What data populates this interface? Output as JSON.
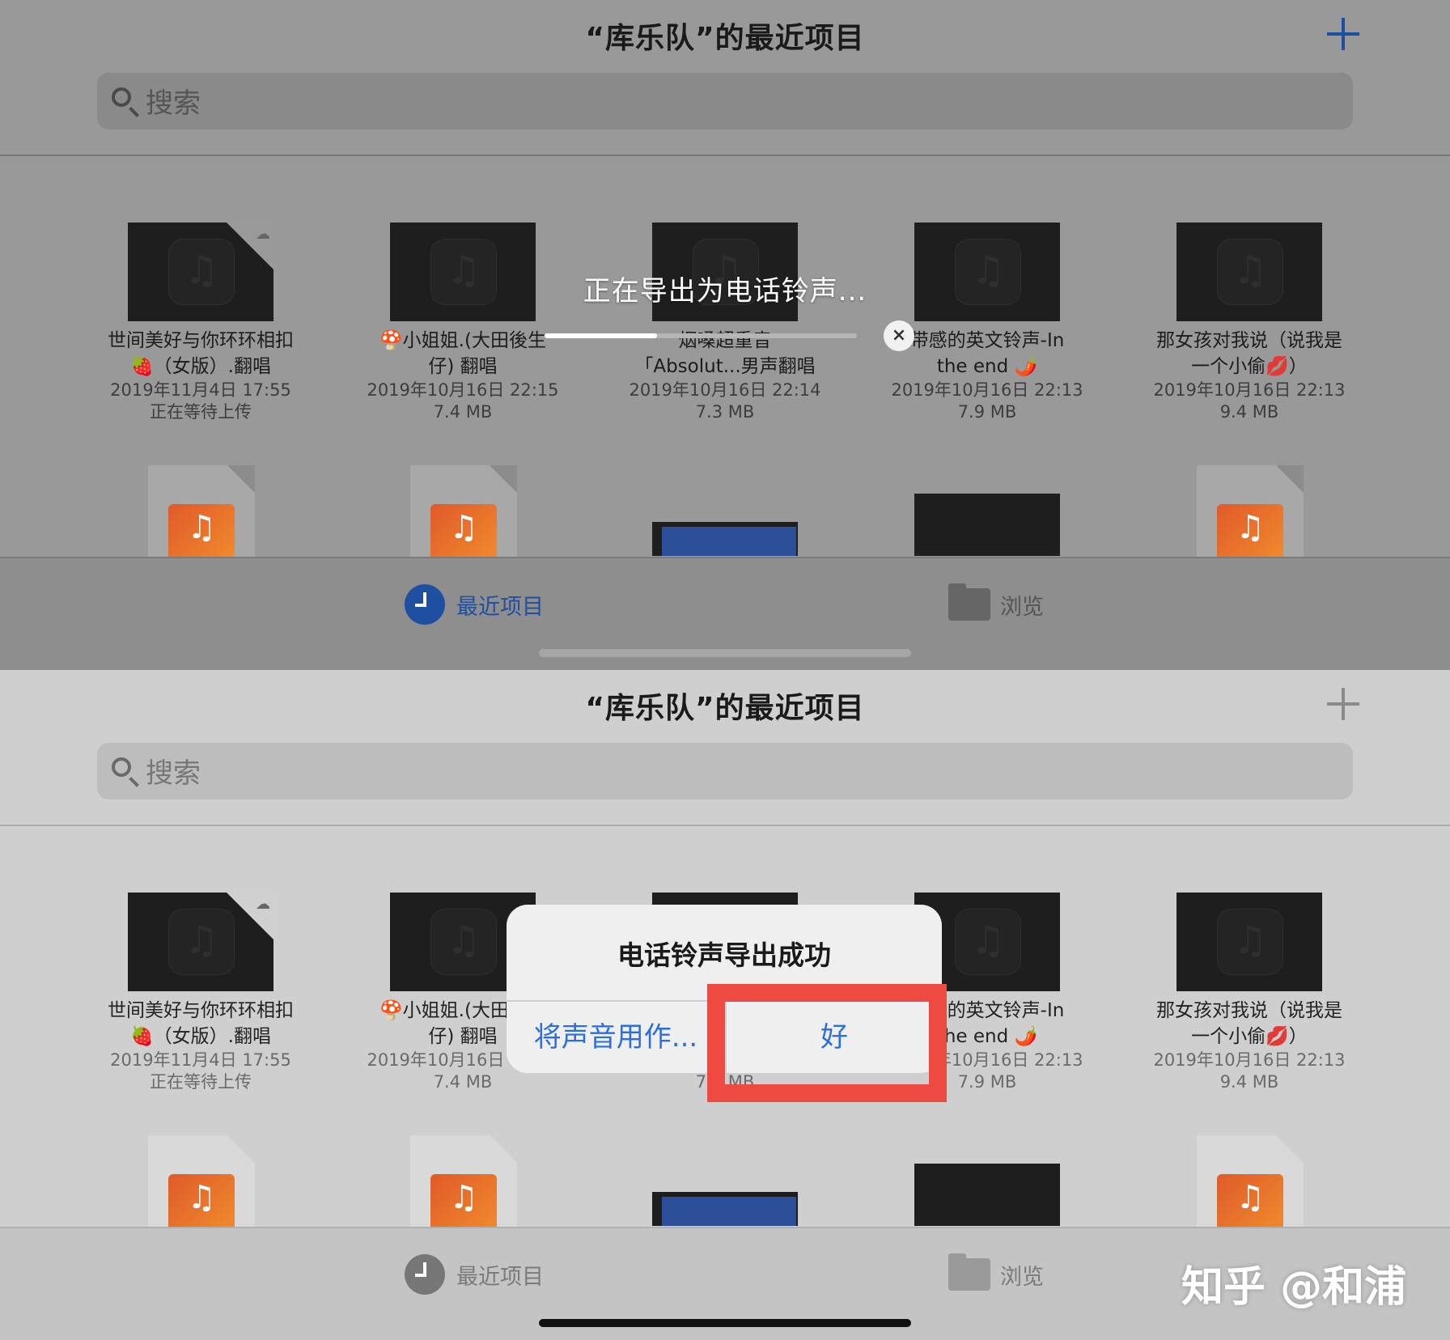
{
  "header": {
    "title": "“库乐队”的最近项目"
  },
  "search": {
    "placeholder": "搜索"
  },
  "files": [
    {
      "name_line1": "世间美好与你环环相扣",
      "name_line2": "🍓（女版）.翻唱",
      "date": "2019年11月4日 17:55",
      "meta": "正在等待上传",
      "cloud": true
    },
    {
      "name_line1": "🍄小姐姐.(大田後生",
      "name_line2": "仔) 翻唱",
      "date": "2019年10月16日 22:15",
      "meta": "7.4 MB",
      "cloud": false
    },
    {
      "name_line1": "烟嗓超重音",
      "name_line2": "「Absolut...男声翻唱",
      "date": "2019年10月16日 22:14",
      "meta": "7.3 MB",
      "cloud": false
    },
    {
      "name_line1": "带感的英文铃声-In",
      "name_line2": "the end 🌶️",
      "date": "2019年10月16日 22:13",
      "meta": "7.9 MB",
      "cloud": false
    },
    {
      "name_line1": "那女孩对我说（说我是",
      "name_line2": "一个小偷💋）",
      "date": "2019年10月16日 22:13",
      "meta": "9.4 MB",
      "cloud": false
    }
  ],
  "tabs": {
    "recent": "最近项目",
    "browse": "浏览"
  },
  "export": {
    "status": "正在导出为电话铃声...",
    "progress": 0.36,
    "cancel_glyph": "×"
  },
  "alert": {
    "title": "电话铃声导出成功",
    "use_as": "将声音用作...",
    "ok": "好"
  },
  "watermark": "知乎 @和浦",
  "colors": {
    "accent": "#1f4fa0",
    "alert_button": "#2a6fdb",
    "highlight": "#ee4a44"
  }
}
